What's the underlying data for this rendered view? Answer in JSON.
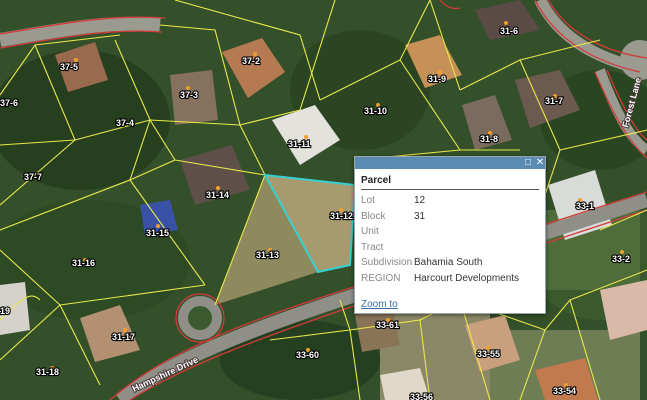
{
  "map": {
    "parcel_labels": [
      "37-5",
      "37-2",
      "37-3",
      "37-4",
      "37-6",
      "37-7",
      "31-11",
      "31-10",
      "31-9",
      "31-8",
      "31-7",
      "31-6",
      "31-14",
      "31-15",
      "31-16",
      "31-13",
      "31-12",
      "31-17",
      "31-18",
      "33-61",
      "33-60",
      "33-55",
      "33-54",
      "33-1",
      "33-2",
      "33-56",
      "19"
    ],
    "street_labels": [
      "Hampshire Drive",
      "Forest Lane"
    ],
    "colors": {
      "parcel_line": "#e8e84a",
      "road_line": "#d23a3a",
      "selection": "#36d1d1"
    }
  },
  "popup": {
    "title": "Parcel",
    "attributes": [
      {
        "key": "Lot",
        "value": "12"
      },
      {
        "key": "Block",
        "value": "31"
      },
      {
        "key": "Unit",
        "value": ""
      },
      {
        "key": "Tract",
        "value": ""
      },
      {
        "key": "Subdivision",
        "value": "Bahamia South"
      },
      {
        "key": "REGION",
        "value": "Harcourt Developments"
      }
    ],
    "zoom_link": "Zoom to",
    "icons": {
      "maximize": "maximize-icon",
      "close": "close-icon"
    }
  }
}
